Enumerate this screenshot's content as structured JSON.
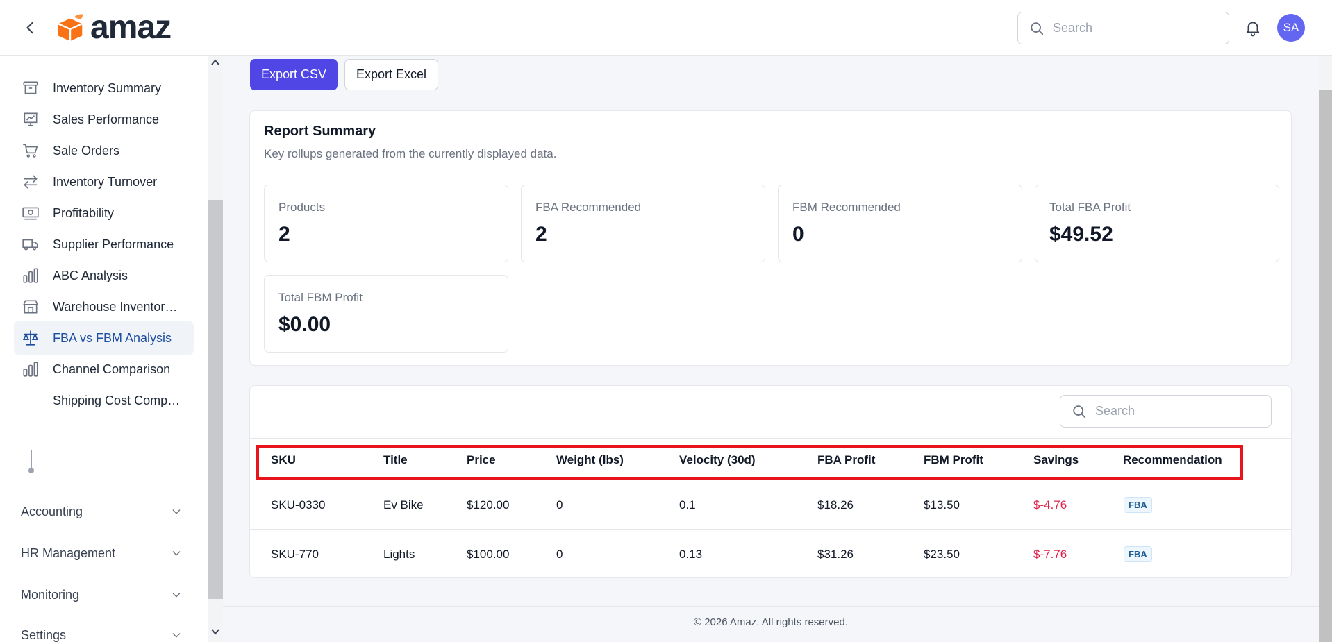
{
  "header": {
    "logo_text": "amaz",
    "search_placeholder": "Search",
    "avatar_initials": "SA"
  },
  "sidebar": {
    "items": [
      {
        "label": "Inventory Summary",
        "icon": "archive-box-icon"
      },
      {
        "label": "Sales Performance",
        "icon": "presentation-chart-icon"
      },
      {
        "label": "Sale Orders",
        "icon": "shopping-cart-icon"
      },
      {
        "label": "Inventory Turnover",
        "icon": "arrows-right-left-icon"
      },
      {
        "label": "Profitability",
        "icon": "banknotes-icon"
      },
      {
        "label": "Supplier Performance",
        "icon": "truck-icon"
      },
      {
        "label": "ABC Analysis",
        "icon": "bar-chart-icon"
      },
      {
        "label": "Warehouse Inventor…",
        "icon": "building-storefront-icon"
      },
      {
        "label": "FBA vs FBM Analysis",
        "icon": "scale-icon",
        "active": true
      },
      {
        "label": "Channel Comparison",
        "icon": "bar-chart-icon"
      },
      {
        "label": "Shipping Cost Comp…",
        "icon": "sub-item-dot"
      }
    ],
    "groups": [
      {
        "label": "Accounting"
      },
      {
        "label": "HR Management"
      },
      {
        "label": "Monitoring"
      },
      {
        "label": "Settings"
      }
    ]
  },
  "toolbar": {
    "export_csv": "Export CSV",
    "export_excel": "Export Excel"
  },
  "summary": {
    "title": "Report Summary",
    "subtitle": "Key rollups generated from the currently displayed data.",
    "stats": [
      {
        "label": "Products",
        "value": "2"
      },
      {
        "label": "FBA Recommended",
        "value": "2"
      },
      {
        "label": "FBM Recommended",
        "value": "0"
      },
      {
        "label": "Total FBA Profit",
        "value": "$49.52"
      },
      {
        "label": "Total FBM Profit",
        "value": "$0.00"
      }
    ]
  },
  "table": {
    "search_placeholder": "Search",
    "columns": [
      "SKU",
      "Title",
      "Price",
      "Weight (lbs)",
      "Velocity (30d)",
      "FBA Profit",
      "FBM Profit",
      "Savings",
      "Recommendation"
    ],
    "rows": [
      [
        "SKU-0330",
        "Ev Bike",
        "$120.00",
        "0",
        "0.1",
        "$18.26",
        "$13.50",
        "$-4.76",
        "FBA"
      ],
      [
        "SKU-770",
        "Lights",
        "$100.00",
        "0",
        "0.13",
        "$31.26",
        "$23.50",
        "$-7.76",
        "FBA"
      ]
    ]
  },
  "footer": {
    "copyright": "© 2026 Amaz. All rights reserved."
  },
  "colors": {
    "accent": "#4f46e5",
    "avatar": "#6366f1",
    "active_nav_text": "#1e4fa0",
    "negative": "#e11d48",
    "highlight_box": "#e8141c",
    "logo_orange": "#f97316"
  }
}
